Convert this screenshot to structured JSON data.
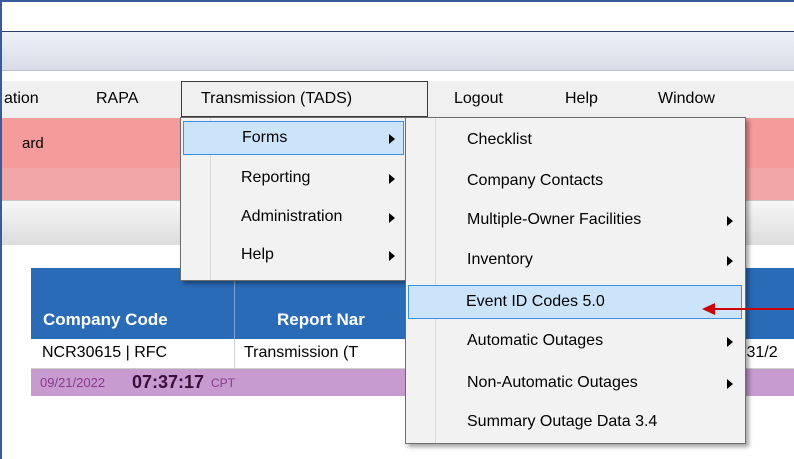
{
  "menubar": {
    "items": [
      "ation",
      "RAPA",
      "Transmission (TADS)",
      "Logout",
      "Help",
      "Window"
    ]
  },
  "pink_row": {
    "text": "ard"
  },
  "forms_menu": {
    "items": [
      {
        "label": "Forms",
        "submenu": true,
        "highlighted": true
      },
      {
        "label": "Reporting",
        "submenu": true
      },
      {
        "label": "Administration",
        "submenu": true
      },
      {
        "label": "Help",
        "submenu": true
      }
    ]
  },
  "forms_submenu": {
    "items": [
      {
        "label": "Checklist",
        "submenu": false
      },
      {
        "label": "Company Contacts",
        "submenu": false
      },
      {
        "label": "Multiple-Owner Facilities",
        "submenu": true
      },
      {
        "label": "Inventory",
        "submenu": true
      },
      {
        "label": "Event ID Codes 5.0",
        "submenu": false,
        "highlighted": true
      },
      {
        "label": "Automatic Outages",
        "submenu": true
      },
      {
        "label": "Non-Automatic Outages",
        "submenu": true
      },
      {
        "label": "Summary Outage Data 3.4",
        "submenu": false
      }
    ]
  },
  "table": {
    "headers": [
      "Company Code",
      "Report Nar"
    ],
    "row": [
      "NCR30615 | RFC",
      "Transmission (T",
      "/31/2"
    ]
  },
  "status": {
    "date": "09/21/2022",
    "time": "07:37:17",
    "tz": "CPT"
  },
  "colors": {
    "header_blue": "#2a6bb8",
    "highlight": "#cce4fa",
    "pink": "#f59b9b",
    "status_purple": "#c79bd0",
    "arrow_red": "#cc0000"
  }
}
